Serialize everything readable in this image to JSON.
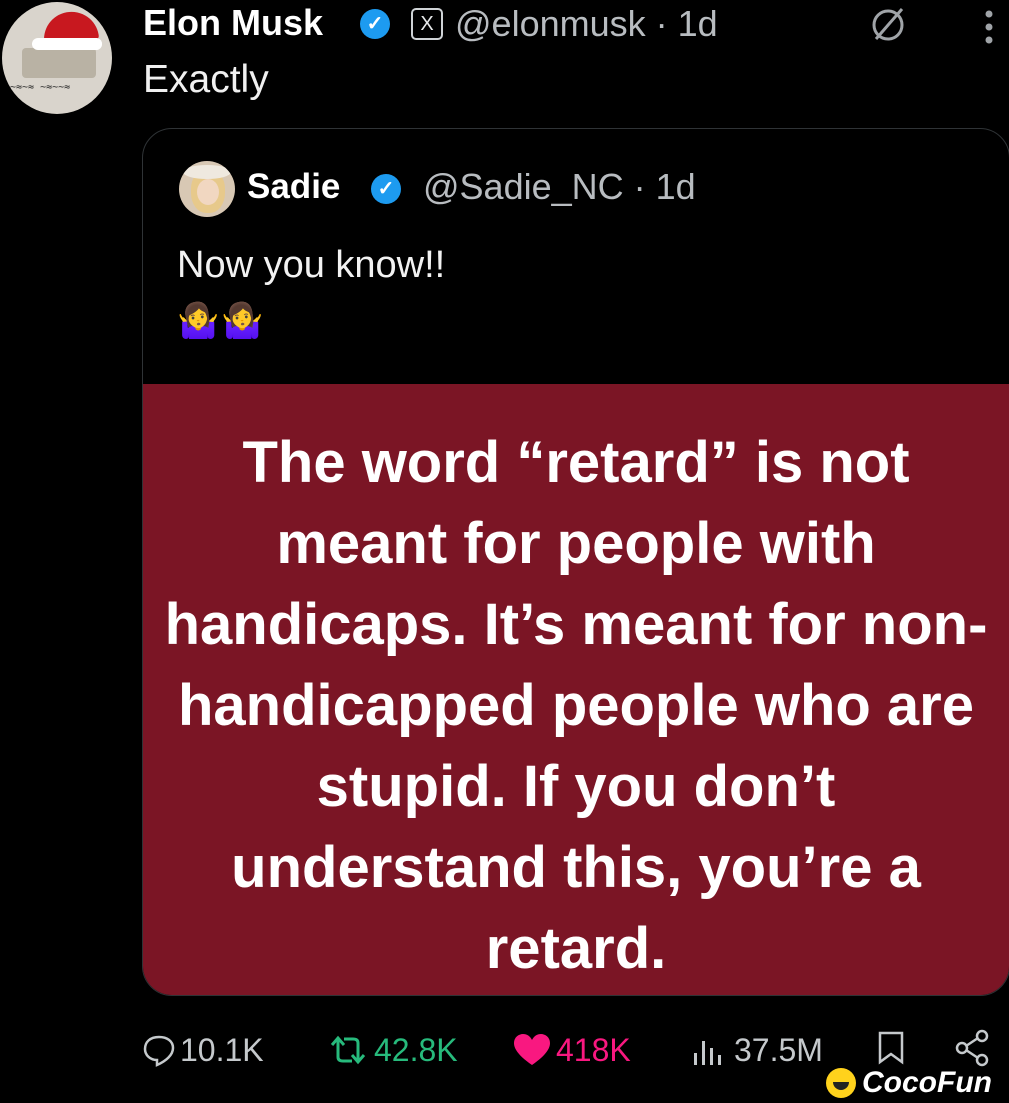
{
  "tweet": {
    "author_name": "Elon Musk",
    "handle_time": "@elonmusk · 1d",
    "x_badge": "X",
    "text": "Exactly"
  },
  "quote": {
    "author_name": "Sadie",
    "handle_time": "@Sadie_NC · 1d",
    "text": "Now you know!!",
    "emoji": "🤷‍♀️🤷‍♀️",
    "meme_text": "The word “retard” is not meant for people with handicaps. It’s meant for non-handicapped people who are stupid. If you don’t understand this, you’re a retard."
  },
  "actions": {
    "replies": "10.1K",
    "retweets": "42.8K",
    "likes": "418K",
    "views": "37.5M"
  },
  "watermark": "CocoFun",
  "icons": [
    "verified-icon",
    "x-logo-icon",
    "grok-icon",
    "more-icon",
    "reply-icon",
    "retweet-icon",
    "heart-icon",
    "views-icon",
    "bookmark-icon",
    "share-icon"
  ],
  "colors": {
    "verified": "#1d9bf0",
    "retweet": "#27ba7c",
    "like": "#f91880",
    "meme_bg": "#7b1525"
  }
}
